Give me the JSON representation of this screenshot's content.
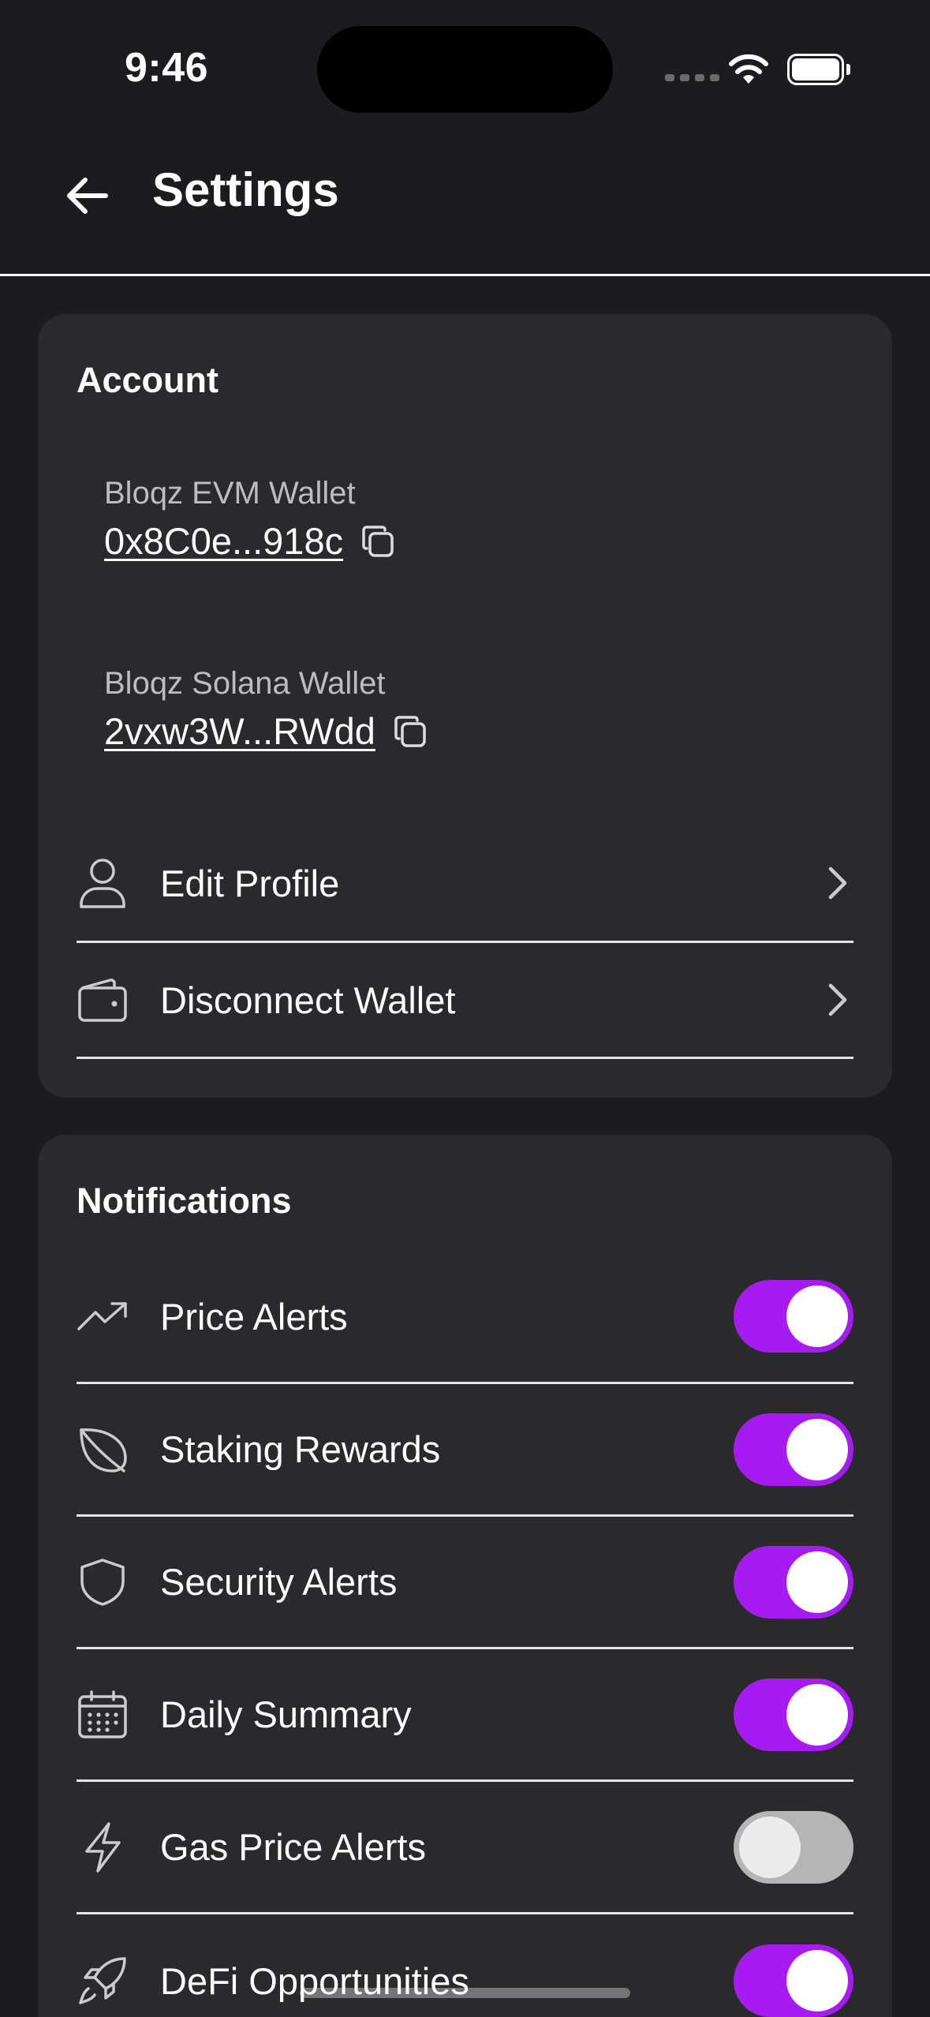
{
  "status_bar": {
    "time": "9:46"
  },
  "header": {
    "title": "Settings",
    "back_icon": "arrow-left-icon"
  },
  "account": {
    "title": "Account",
    "wallets": [
      {
        "label": "Bloqz EVM Wallet",
        "address": "0x8C0e...918c"
      },
      {
        "label": "Bloqz Solana Wallet",
        "address": "2vxw3W...RWdd"
      }
    ],
    "rows": [
      {
        "label": "Edit Profile",
        "icon": "user-icon"
      },
      {
        "label": "Disconnect Wallet",
        "icon": "wallet-icon"
      }
    ]
  },
  "notifications": {
    "title": "Notifications",
    "items": [
      {
        "label": "Price Alerts",
        "icon": "trending-up-icon",
        "enabled": true
      },
      {
        "label": "Staking Rewards",
        "icon": "leaf-icon",
        "enabled": true
      },
      {
        "label": "Security Alerts",
        "icon": "shield-icon",
        "enabled": true
      },
      {
        "label": "Daily Summary",
        "icon": "calendar-icon",
        "enabled": true
      },
      {
        "label": "Gas Price Alerts",
        "icon": "lightning-icon",
        "enabled": false
      },
      {
        "label": "DeFi Opportunities",
        "icon": "rocket-icon",
        "enabled": true
      }
    ]
  },
  "colors": {
    "accent": "#a61bf2",
    "background": "#1c1c1e",
    "card": "#2a2a2c",
    "toggle_off": "#b5b5b5"
  }
}
